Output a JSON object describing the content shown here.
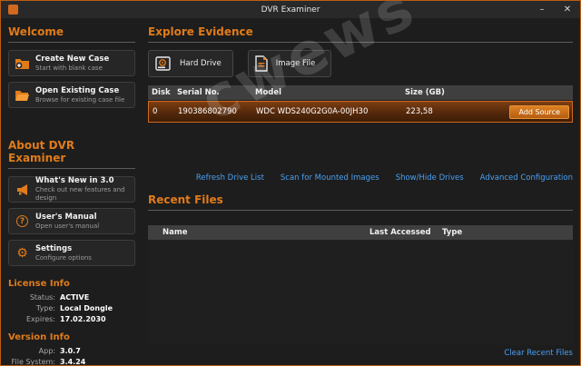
{
  "window": {
    "title": "DVR Examiner",
    "minimize_label": "–",
    "close_label": "✕"
  },
  "watermark": "cwews",
  "colors": {
    "accent_orange": "#e07b1a",
    "selected_row_border": "#d2691e",
    "link_blue": "#4aa0f2",
    "window_bg": "#1d1d1d",
    "table_header_bg": "#3f3f3f"
  },
  "sidebar": {
    "welcome_heading": "Welcome",
    "welcome_items": [
      {
        "label": "Create New Case",
        "sublabel": "Start with blank case",
        "icon": "folder-plus-icon"
      },
      {
        "label": "Open Existing Case",
        "sublabel": "Browse for existing case file",
        "icon": "folder-open-icon"
      }
    ],
    "about_heading": "About DVR Examiner",
    "about_items": [
      {
        "label": "What's New in 3.0",
        "sublabel": "Check out new features and design",
        "icon": "megaphone-icon"
      },
      {
        "label": "User's Manual",
        "sublabel": "Open user's manual",
        "icon": "help-icon"
      },
      {
        "label": "Settings",
        "sublabel": "Configure options",
        "icon": "gear-icon"
      }
    ],
    "license_heading": "License Info",
    "license": [
      {
        "label": "Status:",
        "value": "ACTIVE"
      },
      {
        "label": "Type:",
        "value": "Local Dongle"
      },
      {
        "label": "Expires:",
        "value": "17.02.2030"
      }
    ],
    "version_heading": "Version Info",
    "version": [
      {
        "label": "App:",
        "value": "3.0.7"
      },
      {
        "label": "File System:",
        "value": "3.4.24"
      }
    ]
  },
  "main": {
    "explore_heading": "Explore Evidence",
    "source_buttons": [
      {
        "label": "Hard Drive",
        "icon": "hard-drive-icon"
      },
      {
        "label": "Image File",
        "icon": "image-file-icon"
      }
    ],
    "drives_table": {
      "headers": [
        "Disk",
        "Serial No.",
        "Model",
        "Size (GB)"
      ],
      "rows": [
        {
          "disk": "0",
          "serial": "190386802790",
          "model": "WDC WDS240G2G0A-00JH30",
          "size": "223,58",
          "action": "Add Source"
        }
      ]
    },
    "drive_links": [
      "Refresh Drive List",
      "Scan for Mounted Images",
      "Show/Hide Drives",
      "Advanced Configuration"
    ],
    "recent_heading": "Recent Files",
    "recent_table": {
      "headers": [
        "Name",
        "Last Accessed",
        "Type"
      ]
    },
    "clear_recent_label": "Clear Recent Files"
  }
}
